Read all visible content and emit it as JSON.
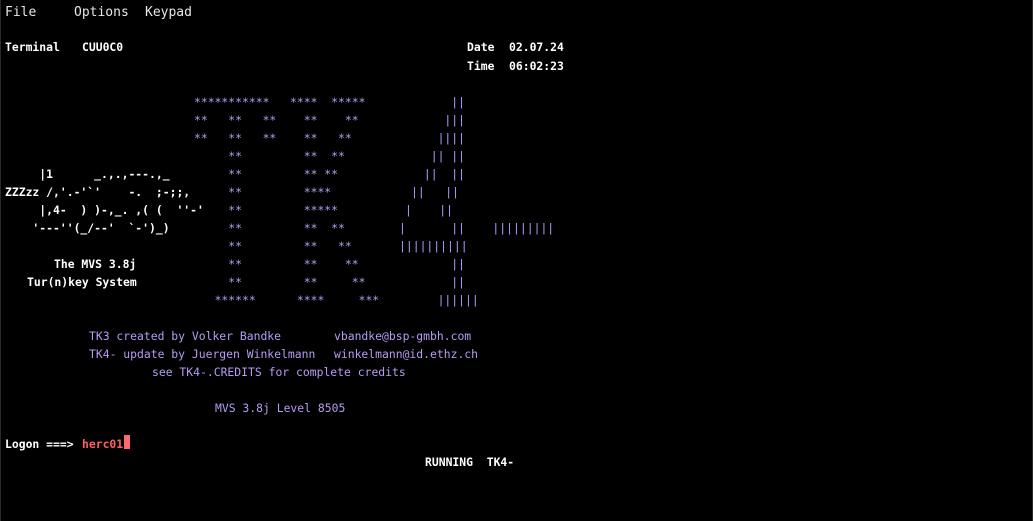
{
  "menu": {
    "file": "File",
    "options": "Options",
    "keypad": "Keypad"
  },
  "header": {
    "terminal_label": "Terminal",
    "terminal_id": "CUU0C0",
    "date_label": "Date",
    "date_value": "02.07.24",
    "time_label": "Time",
    "time_value": "06:02:23"
  },
  "logo_stars": [
    "***********   ****  *****",
    "**   **   **    **    **",
    "**   **   **    **   **",
    "     **         **  **",
    "     **         ** **",
    "     **         ****",
    "     **         *****",
    "     **         **  **",
    "     **         **   **",
    "     **         **    **",
    "     **         **     **",
    "   ******      ****     ***"
  ],
  "logo_bars": [
    "     ||",
    "    |||",
    "   ||||",
    "  || ||",
    " ||  ||",
    "||   ||",
    "|    ||",
    "     ||    |||||||||",
    "||||||||||",
    "     ||",
    "     ||",
    "   ||||||"
  ],
  "logo_bars_partial_left": [
    "|",
    "|"
  ],
  "turnkey_art": [
    "     |1      _.,.,---.,_",
    "ZZZzz /,'.-'`'    -.  ;-;;,",
    "     |,4-  ) )-,_. ,( (  ''-'",
    "    '---''(_/--'  `-')_)"
  ],
  "system_name": "The MVS 3.8j",
  "system_subtitle": "Tur(n)key System",
  "credits": {
    "line1_text": "TK3 created by Volker Bandke",
    "line1_email": "vbandke@bsp-gmbh.com",
    "line2_text": "TK4- update by Juergen Winkelmann",
    "line2_email": "winkelmann@id.ethz.ch",
    "line3": "see TK4-.CREDITS for complete credits"
  },
  "level": "MVS 3.8j Level 8505",
  "logon": {
    "prompt": "Logon ===>",
    "value": "herc01"
  },
  "status": "RUNNING  TK4-"
}
